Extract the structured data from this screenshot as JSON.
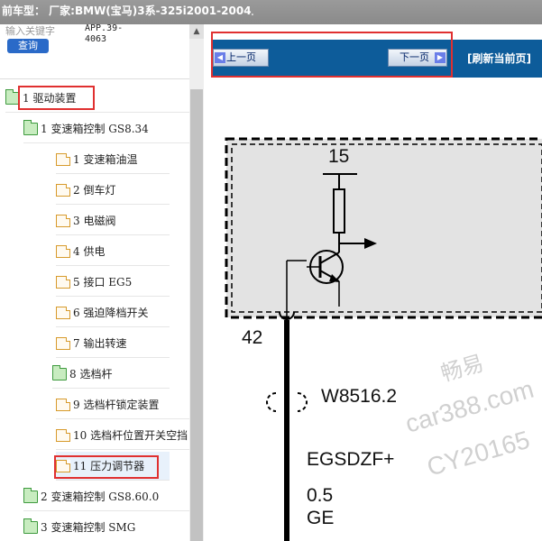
{
  "title_bar": {
    "text": "前车型：  厂家:BMW(宝马)3系-325i2001-2004",
    "dot": "."
  },
  "search": {
    "placeholder": "输入关键字",
    "button_label": "查询",
    "app_code": "APP.39-4063"
  },
  "tree": {
    "items": [
      {
        "label": "1 驱动装置",
        "type": "folder"
      },
      {
        "label": "1 变速箱控制 GS8.34",
        "type": "folder"
      },
      {
        "label": "1 变速箱油温",
        "type": "page"
      },
      {
        "label": "2 倒车灯",
        "type": "page"
      },
      {
        "label": "3 电磁阀",
        "type": "page"
      },
      {
        "label": "4 供电",
        "type": "page"
      },
      {
        "label": "5 接口 EG5",
        "type": "page"
      },
      {
        "label": "6 强迫降档开关",
        "type": "page"
      },
      {
        "label": "7 输出转速",
        "type": "page"
      },
      {
        "label": "8 选档杆",
        "type": "folder"
      },
      {
        "label": "9 选档杆锁定装置",
        "type": "page"
      },
      {
        "label": "10 选档杆位置开关空挡",
        "type": "page"
      },
      {
        "label": "11 压力调节器",
        "type": "page"
      },
      {
        "label": "2 变速箱控制 GS8.60.0",
        "type": "folder"
      },
      {
        "label": "3 变速箱控制 SMG",
        "type": "folder"
      }
    ]
  },
  "nav": {
    "prev_label": "上一页",
    "next_label": "下一页",
    "refresh_label": "[刷新当前页]"
  },
  "diagram": {
    "pin_top": "15",
    "pin_left": "42",
    "wire_code": "W8516.2",
    "signal_name": "EGSDZF+",
    "wire_size": "0.5",
    "wire_color": "GE"
  },
  "watermark": {
    "line1": "畅易",
    "line2": "car388.com",
    "line3": "CY20165"
  },
  "colors": {
    "nav_bar": "#0d5c9a",
    "highlight_box": "#e03030",
    "query_button": "#2a6ac8",
    "title_bar": "#8a8a8a"
  }
}
